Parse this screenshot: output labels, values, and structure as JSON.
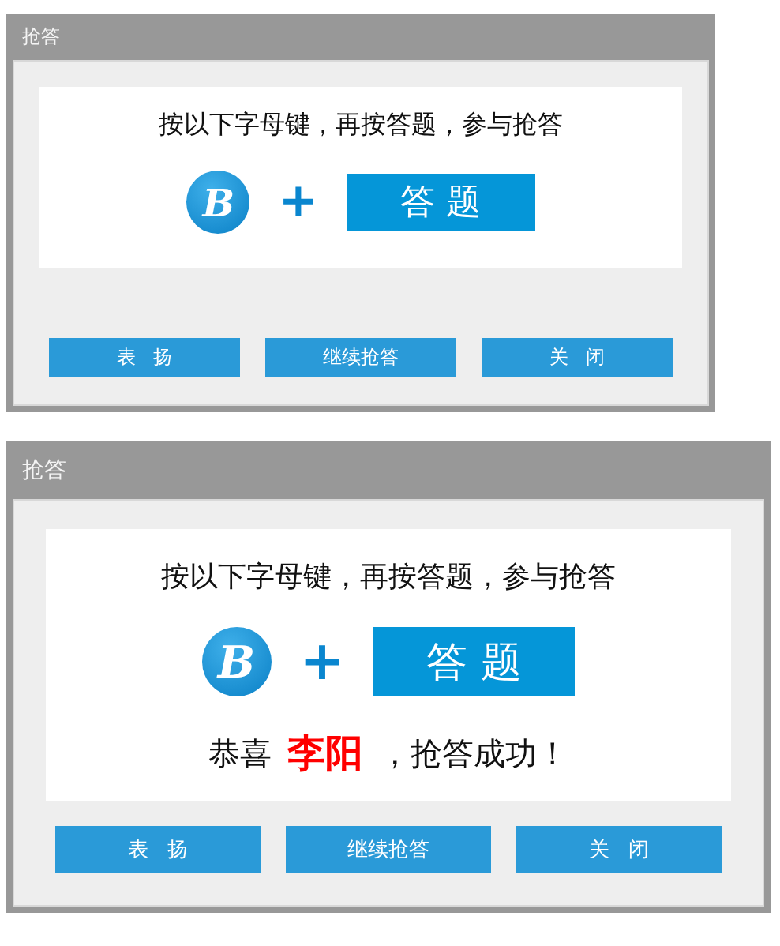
{
  "dialogs": [
    {
      "title": "抢答",
      "instruction": "按以下字母键，再按答题，参与抢答",
      "key_letter": "B",
      "plus": "+",
      "answer_button": "答 题",
      "buttons": [
        "表   扬",
        "继续抢答",
        "关   闭"
      ]
    },
    {
      "title": "抢答",
      "instruction": "按以下字母键，再按答题，参与抢答",
      "key_letter": "B",
      "plus": "+",
      "answer_button": "答 题",
      "result": {
        "prefix": "恭喜",
        "name": "李阳",
        "suffix": "，抢答成功！"
      },
      "buttons": [
        "表   扬",
        "继续抢答",
        "关   闭"
      ]
    }
  ]
}
